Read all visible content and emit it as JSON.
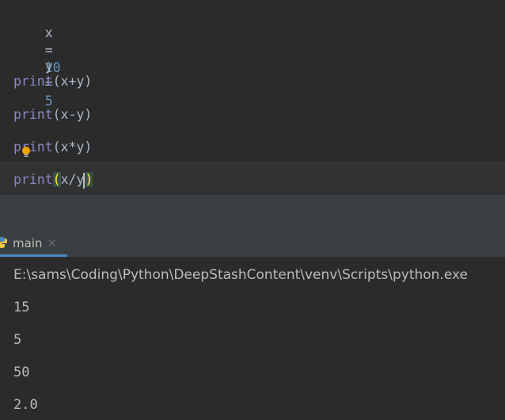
{
  "editor": {
    "lines": [
      {
        "var": "x",
        "op": "=",
        "value": "10"
      },
      {
        "var": "y",
        "op": "=",
        "value": "5"
      },
      {
        "fn": "print",
        "args": "x+y"
      },
      {
        "fn": "print",
        "args": "x-y"
      },
      {
        "fn": "print",
        "args": "x*y"
      },
      {
        "fn": "print",
        "args": "x/y"
      }
    ],
    "bulb_icon": "intention-bulb-icon"
  },
  "run_panel": {
    "tab_label": "main",
    "tab_close": "×",
    "tab_icon": "python-icon"
  },
  "console": {
    "lines": [
      "E:\\sams\\Coding\\Python\\DeepStashContent\\venv\\Scripts\\python.exe",
      "15",
      "5",
      "50",
      "2.0"
    ]
  },
  "colors": {
    "editor_bg": "#2b2b2b",
    "panel_bg": "#3c3f41",
    "number": "#6897bb",
    "builtin": "#8888c6",
    "text": "#a9b7c6",
    "brace_match": "#ffef28",
    "tab_underline": "#4a88c7"
  }
}
